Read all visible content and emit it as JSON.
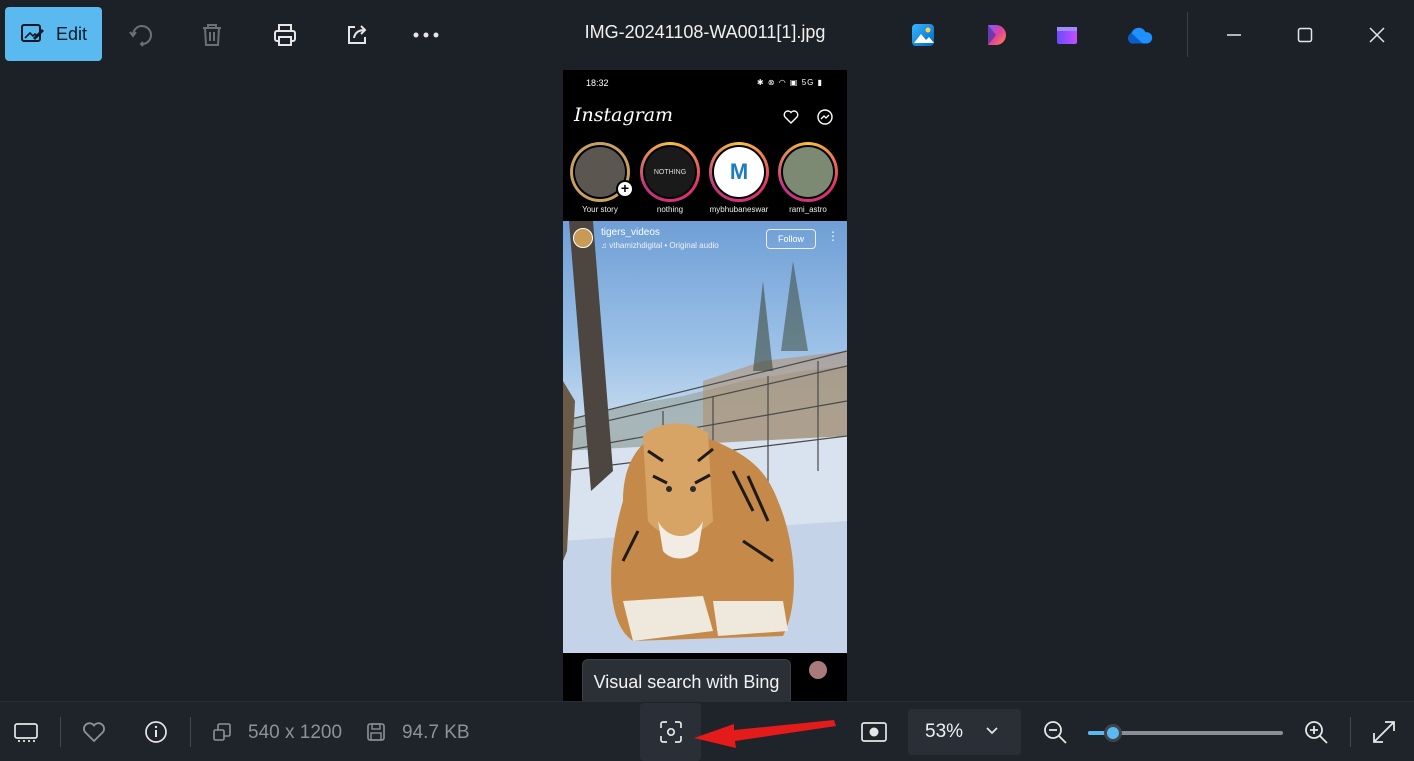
{
  "toolbar": {
    "edit_label": "Edit",
    "file_name": "IMG-20241108-WA0011[1].jpg"
  },
  "phone": {
    "status_time": "18:32",
    "status_right": "5G",
    "app_name": "Instagram",
    "stories": [
      {
        "label": "Your story",
        "inner": ""
      },
      {
        "label": "nothing",
        "inner": "NOTHING"
      },
      {
        "label": "mybhubaneswar",
        "inner": "M"
      },
      {
        "label": "rami_astro",
        "inner": ""
      }
    ],
    "reel": {
      "user": "tigers_videos",
      "audio": "vthamizhdigital • Original audio",
      "follow": "Follow"
    }
  },
  "tooltip": "Visual search with Bing",
  "bottom": {
    "dimensions": "540 x 1200",
    "file_size": "94.7 KB",
    "zoom": "53%",
    "zoom_level": 0.13
  },
  "colors": {
    "accent": "#5ab9ef",
    "background": "#1c2027",
    "arrow": "#e31b1b"
  }
}
